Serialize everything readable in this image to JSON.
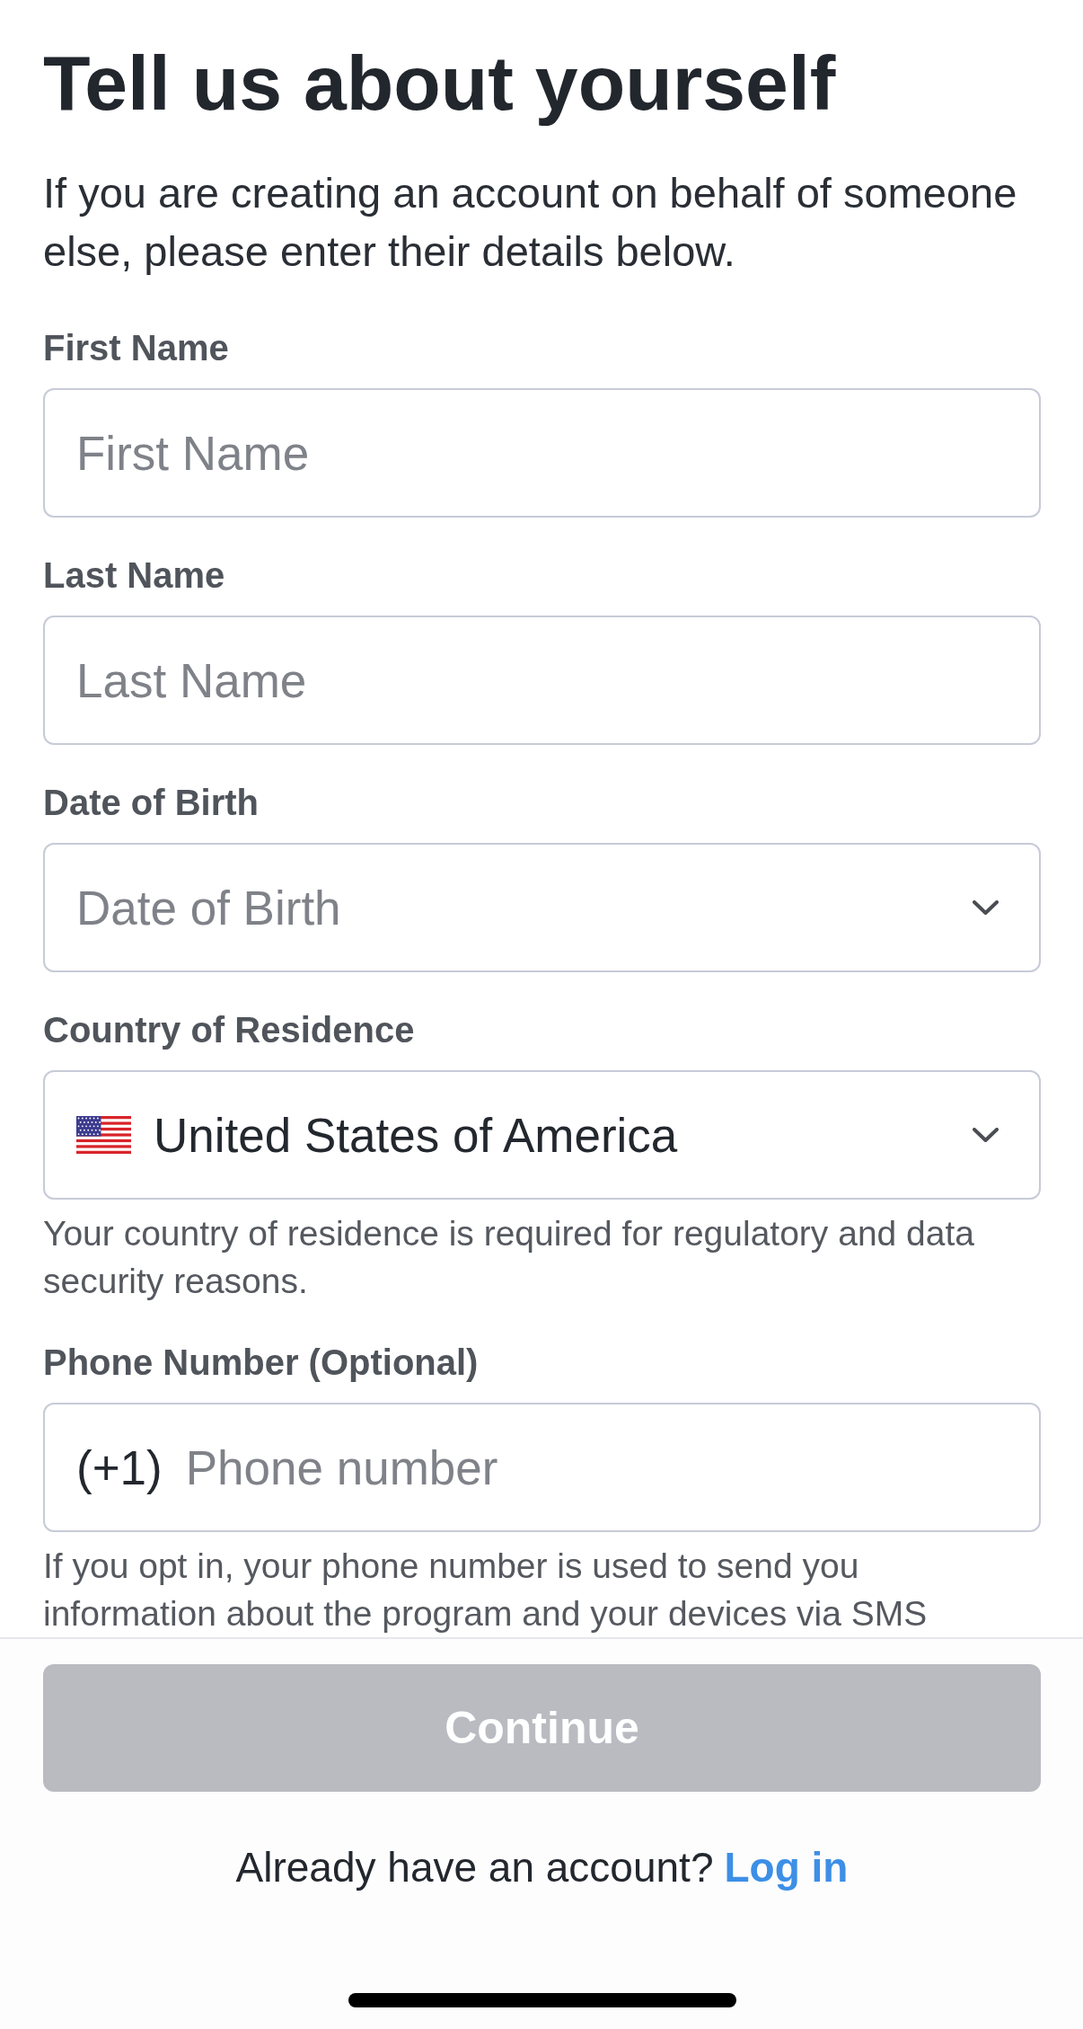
{
  "title": "Tell us about yourself",
  "intro": "If you are creating an account on behalf of someone else, please enter their details below.",
  "fields": [
    {
      "kind": "text",
      "label": "First Name",
      "placeholder": "First Name"
    },
    {
      "kind": "text",
      "label": "Last Name",
      "placeholder": "Last Name"
    },
    {
      "kind": "dropdown",
      "label": "Date of Birth",
      "placeholder": "Date of Birth"
    },
    {
      "kind": "country",
      "label": "Country of Residence",
      "value": "United States of America",
      "help": "Your country of residence is required for regulatory and data security reasons."
    },
    {
      "kind": "phone",
      "label": "Phone Number (Optional)",
      "prefix": "(+1)",
      "placeholder": "Phone number",
      "help": "If you opt in, your phone number is used to send you information about the program and your devices via SMS"
    }
  ],
  "continue_button": {
    "label": "Continue",
    "disabled": true
  },
  "login_prompt": {
    "text": "Already have an account?",
    "link": "Log in"
  }
}
